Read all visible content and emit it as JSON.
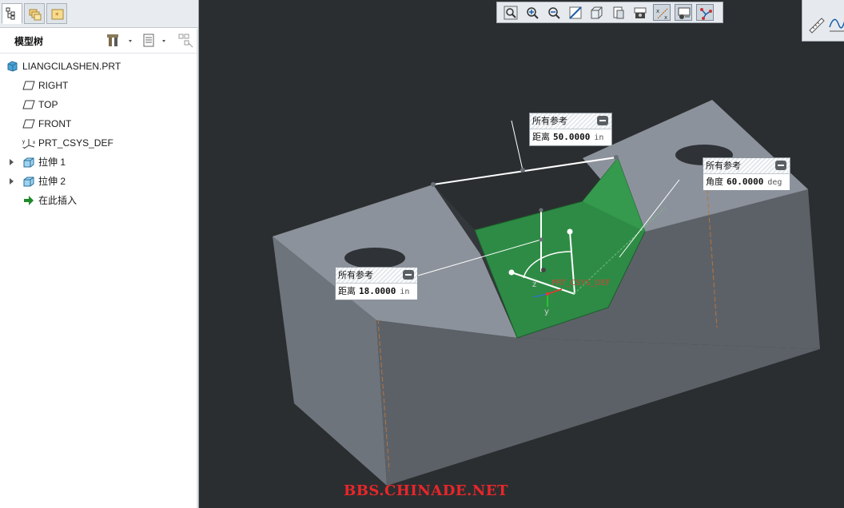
{
  "model_tree": {
    "title": "模型树",
    "items": [
      {
        "label": "LIANGCILASHEN.PRT",
        "icon": "part-icon"
      },
      {
        "label": "RIGHT",
        "icon": "datum-plane-icon"
      },
      {
        "label": "TOP",
        "icon": "datum-plane-icon"
      },
      {
        "label": "FRONT",
        "icon": "datum-plane-icon"
      },
      {
        "label": "PRT_CSYS_DEF",
        "icon": "csys-icon"
      },
      {
        "label": "拉伸 1",
        "icon": "extrude-icon"
      },
      {
        "label": "拉伸 2",
        "icon": "extrude-icon"
      },
      {
        "label": "在此插入",
        "icon": "insert-arrow-icon"
      }
    ]
  },
  "callouts": [
    {
      "header": "所有参考",
      "label": "距离",
      "value": "50.0000",
      "unit": "in"
    },
    {
      "header": "所有参考",
      "label": "角度",
      "value": "60.0000",
      "unit": "deg"
    },
    {
      "header": "所有参考",
      "label": "距离",
      "value": "18.0000",
      "unit": "in"
    }
  ],
  "csys": {
    "label": "PRT_CSYS_DEF",
    "axis_z": "z",
    "axis_y": "y"
  },
  "watermark": "BBS.CHINADE.NET",
  "colors": {
    "viewport_bg": "#2b2e30",
    "model_gray": "#8a9099",
    "feature_green": "#2e8b45",
    "watermark_red": "#e8262a"
  }
}
